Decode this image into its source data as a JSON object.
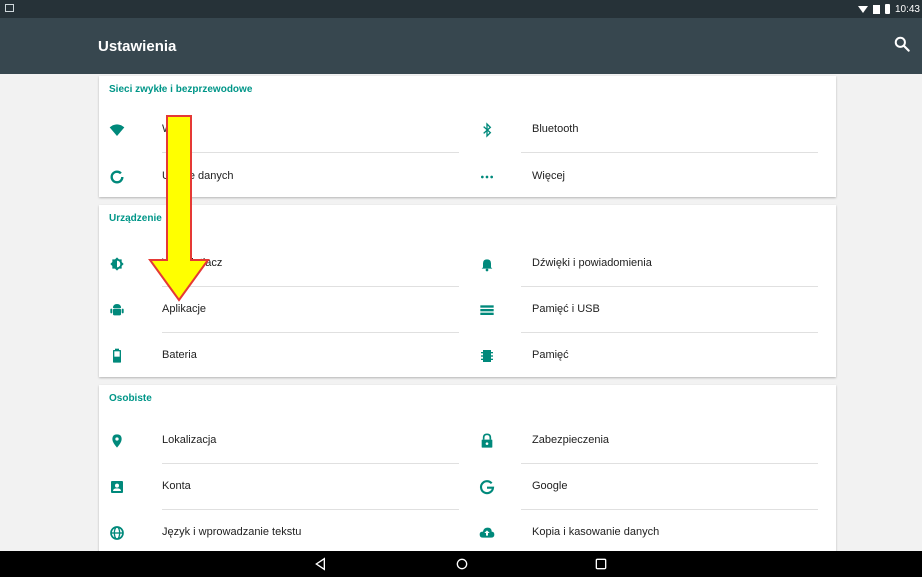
{
  "status_bar": {
    "time": "10:43"
  },
  "app_bar": {
    "title": "Ustawienia"
  },
  "sections": [
    {
      "title": "Sieci zwykłe i bezprzewodowe",
      "items": [
        {
          "label": "Wi-Fi",
          "icon": "wifi-icon"
        },
        {
          "label": "Bluetooth",
          "icon": "bluetooth-icon"
        },
        {
          "label": "Użycie danych",
          "icon": "data-usage-icon"
        },
        {
          "label": "Więcej",
          "icon": "more-icon"
        }
      ]
    },
    {
      "title": "Urządzenie",
      "items": [
        {
          "label": "Wyświetlacz",
          "icon": "brightness-icon"
        },
        {
          "label": "Dźwięki i powiadomienia",
          "icon": "bell-icon"
        },
        {
          "label": "Aplikacje",
          "icon": "android-icon"
        },
        {
          "label": "Pamięć i USB",
          "icon": "storage-icon"
        },
        {
          "label": "Bateria",
          "icon": "battery-icon"
        },
        {
          "label": "Pamięć",
          "icon": "memory-icon"
        }
      ]
    },
    {
      "title": "Osobiste",
      "items": [
        {
          "label": "Lokalizacja",
          "icon": "location-icon"
        },
        {
          "label": "Zabezpieczenia",
          "icon": "lock-icon"
        },
        {
          "label": "Konta",
          "icon": "account-icon"
        },
        {
          "label": "Google",
          "icon": "google-icon"
        },
        {
          "label": "Język i wprowadzanie tekstu",
          "icon": "language-icon"
        },
        {
          "label": "Kopia i kasowanie danych",
          "icon": "backup-icon"
        }
      ]
    }
  ],
  "colors": {
    "accent": "#009688",
    "app_bar": "#37474f",
    "status_bar": "#263238",
    "arrow_fill": "#ffff00",
    "arrow_stroke": "#e53935"
  }
}
